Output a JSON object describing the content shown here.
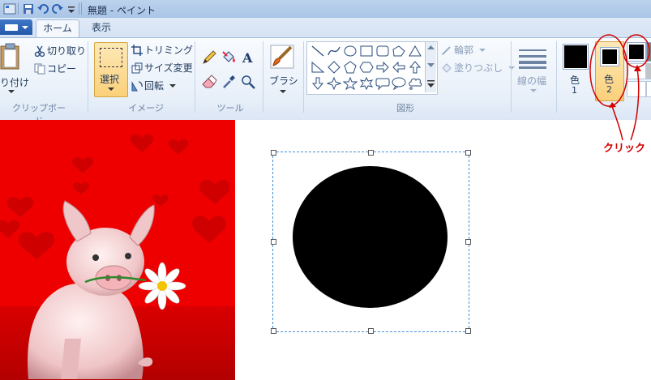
{
  "titlebar": {
    "title": "無題 - ペイント"
  },
  "tabs": {
    "home": "ホーム",
    "view": "表示"
  },
  "clipboard": {
    "paste_label": "貼り付け",
    "cut_label": "切り取り",
    "copy_label": "コピー",
    "group_label": "クリップボード"
  },
  "image": {
    "select_label": "選択",
    "crop_label": "トリミング",
    "resize_label": "サイズ変更",
    "rotate_label": "回転",
    "group_label": "イメージ"
  },
  "tools": {
    "group_label": "ツール"
  },
  "brushes": {
    "label": "ブラシ"
  },
  "shapes": {
    "outline_label": "輪郭",
    "fill_label": "塗りつぶし",
    "group_label": "図形"
  },
  "size": {
    "label": "線の幅"
  },
  "colors": {
    "color1_label": "色",
    "color1_num": "1",
    "color2_label": "色",
    "color2_num": "2",
    "swatch_color": "#000000",
    "selected_bg": "#fcd27c"
  },
  "annotation": {
    "text": "クリック",
    "color": "#d40000"
  },
  "canvas": {
    "ellipse_color": "#000000",
    "picture_bg": "#ee0000"
  }
}
